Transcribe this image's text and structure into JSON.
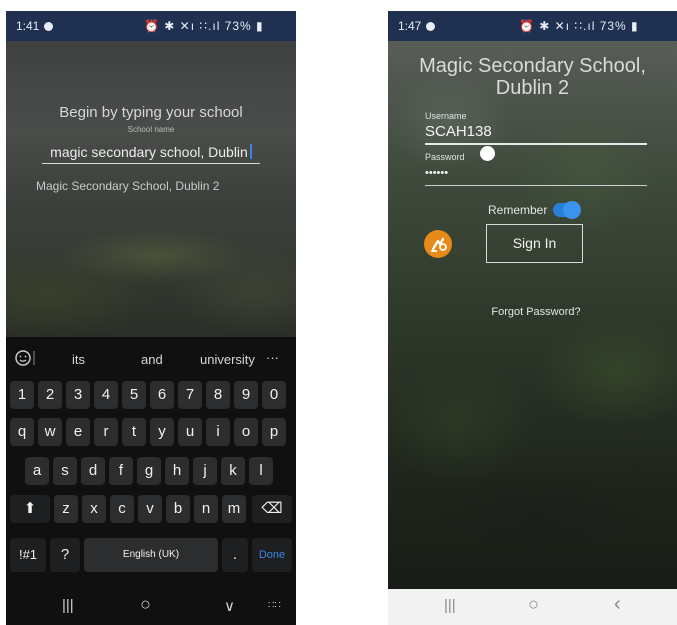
{
  "left_screen": {
    "status_bar": {
      "time": "1:41",
      "icons": "⏰ ✱ ✕ı ∷.ıl 73% ▮",
      "battery": "73%"
    },
    "prompt": "Begin by typing your school",
    "input_label": "School name",
    "input_value": "magic secondary school, Dublin",
    "suggestion": "Magic Secondary School, Dublin 2",
    "keyboard": {
      "suggestions": [
        "its",
        "and",
        "university"
      ],
      "more_label": "···",
      "number_row": [
        "1",
        "2",
        "3",
        "4",
        "5",
        "6",
        "7",
        "8",
        "9",
        "0"
      ],
      "row1": [
        "q",
        "w",
        "e",
        "r",
        "t",
        "y",
        "u",
        "i",
        "o",
        "p"
      ],
      "row2": [
        "a",
        "s",
        "d",
        "f",
        "g",
        "h",
        "j",
        "k",
        "l"
      ],
      "row3": [
        "z",
        "x",
        "c",
        "v",
        "b",
        "n",
        "m"
      ],
      "symbols_label": "!#1",
      "question_label": "?",
      "space_label": "English (UK)",
      "period_label": ".",
      "done_label": "Done",
      "shift_icon": "⬆",
      "backspace_icon": "⌫"
    },
    "nav_bar": {
      "recent": "|||",
      "home": "○",
      "back": "∨",
      "keyboard": "∷∷"
    }
  },
  "right_screen": {
    "status_bar": {
      "time": "1:47",
      "icons": "⏰ ✱ ✕ı ∷.ıl 73% ▮",
      "battery": "73%"
    },
    "school_title_line1": "Magic Secondary School,",
    "school_title_line2": "Dublin 2",
    "username_label": "Username",
    "username_value": "SCAH138",
    "password_label": "Password",
    "password_value": "••••••",
    "remember_label": "Remember",
    "remember_on": true,
    "sign_in_label": "Sign In",
    "forgot_label": "Forgot Password?",
    "nav_bar": {
      "recent": "|||",
      "home": "○",
      "back": "‹"
    },
    "colors": {
      "toggle": "#2a7fd6",
      "app_icon": "#e88a1a",
      "status_bar": "#1f3050"
    }
  }
}
